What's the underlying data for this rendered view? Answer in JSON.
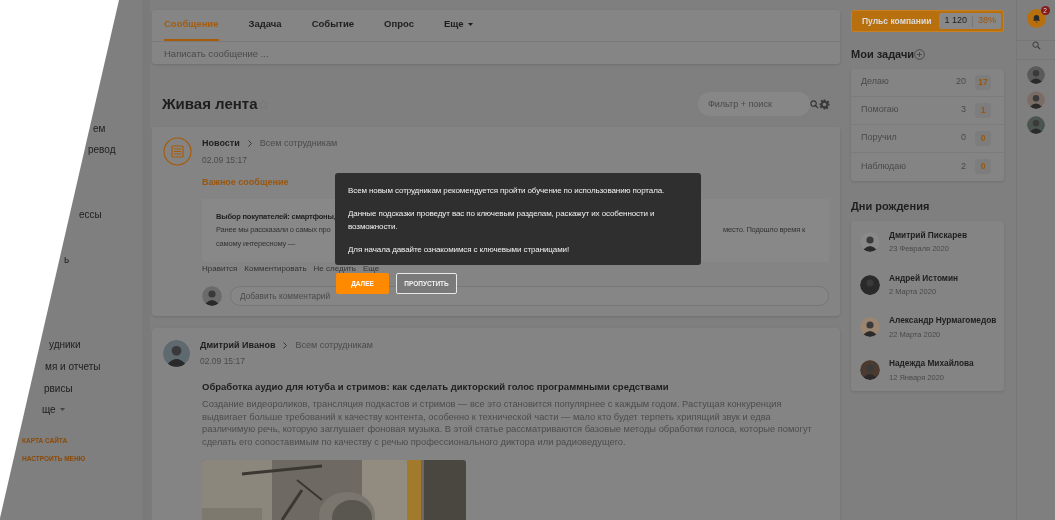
{
  "sidebar": {
    "items": [
      {
        "label": "ем"
      },
      {
        "label": "ревод"
      },
      {
        "label": "ессы"
      },
      {
        "label": "ь"
      },
      {
        "label": "удники"
      },
      {
        "label": "мя и отчеты"
      },
      {
        "label": "рвисы"
      },
      {
        "label": "ще",
        "expandable": true
      }
    ],
    "links": [
      "КАРТА САЙТА",
      "НАСТРОИТЬ МЕНЮ"
    ]
  },
  "composer": {
    "tabs": [
      {
        "label": "Сообщение",
        "selected": true,
        "dropdown": false
      },
      {
        "label": "Задача",
        "selected": false,
        "dropdown": false
      },
      {
        "label": "Событие",
        "selected": false,
        "dropdown": false
      },
      {
        "label": "Опрос",
        "selected": false,
        "dropdown": false
      },
      {
        "label": "Еще",
        "selected": false,
        "dropdown": true
      }
    ],
    "placeholder": "Написать сообщение ..."
  },
  "feed": {
    "title": "Живая лента",
    "filter_placeholder": "Фильтр + поиск",
    "posts": [
      {
        "kind": "news",
        "author": "Новости",
        "audience": "Всем сотрудникам",
        "time": "02.09 15:17",
        "label": "Важное сообщение",
        "quote": {
          "title": "Выбор покупателей: смартфоны,",
          "lines": [
            {
              "left": "Ранее мы рассказали о самых про",
              "right": "место. Подошло время к"
            },
            {
              "left": "самому интересному —"
            }
          ]
        },
        "actions": [
          "Нравится",
          "Комментировать",
          "Не следить",
          "Еще"
        ],
        "comment_placeholder": "Добавить комментарий"
      },
      {
        "kind": "article",
        "author": "Дмитрий Иванов",
        "audience": "Всем сотрудникам",
        "time": "02.09 15:17",
        "title": "Обработка аудио для ютуба и стримов: как сделать дикторский голос программными средствами",
        "body": "Создание видеороликов, трансляция подкастов и стримов — все это становится популярнее с каждым годом. Растущая конкуренция выдвигает больше требований к качеству контента, особенно к технической части — мало кто будет терпеть хрипящий звук и едва различимую речь, которую заглушает фоновая музыка. В этой статье рассматриваются базовые методы обработки голоса, которые помогут сделать его сопоставимым по качеству с речью профессионального диктора или радиоведущего."
      }
    ]
  },
  "tour": {
    "lines": [
      "Всем новым сотрудникам рекомендуется пройти обучение по использованию портала.",
      "Данные подсказки проведут вас по ключевым разделам, раскажут их особенности и возможности.",
      "Для начала давайте ознакомимся с ключевыми страницами!"
    ],
    "buttons": [
      {
        "label": "ДАЛЕЕ",
        "kind": "primary"
      },
      {
        "label": "ПРОПУСТИТЬ",
        "kind": "secondary"
      }
    ]
  },
  "pulse": {
    "label": "Пульс компании",
    "value": "1 120",
    "percent": "38%"
  },
  "tasks": {
    "title": "Мои задачи",
    "rows": [
      {
        "label": "Делаю",
        "count": "20",
        "badge": "17"
      },
      {
        "label": "Помогаю",
        "count": "3",
        "badge": "1"
      },
      {
        "label": "Поручил",
        "count": "0",
        "badge": "0"
      },
      {
        "label": "Наблюдаю",
        "count": "2",
        "badge": "0"
      }
    ]
  },
  "birthdays": {
    "title": "Дни рождения",
    "people": [
      {
        "name": "Дмитрий Пискарев",
        "date": "23 Февраля 2020"
      },
      {
        "name": "Андрей Истомин",
        "date": "2 Марта 2020"
      },
      {
        "name": "Александр Нурмагомедов",
        "date": "22 Марта 2020"
      },
      {
        "name": "Надежда Михайлова",
        "date": "12 Января 2020"
      }
    ]
  },
  "rightbar": {
    "notifications": "2"
  }
}
